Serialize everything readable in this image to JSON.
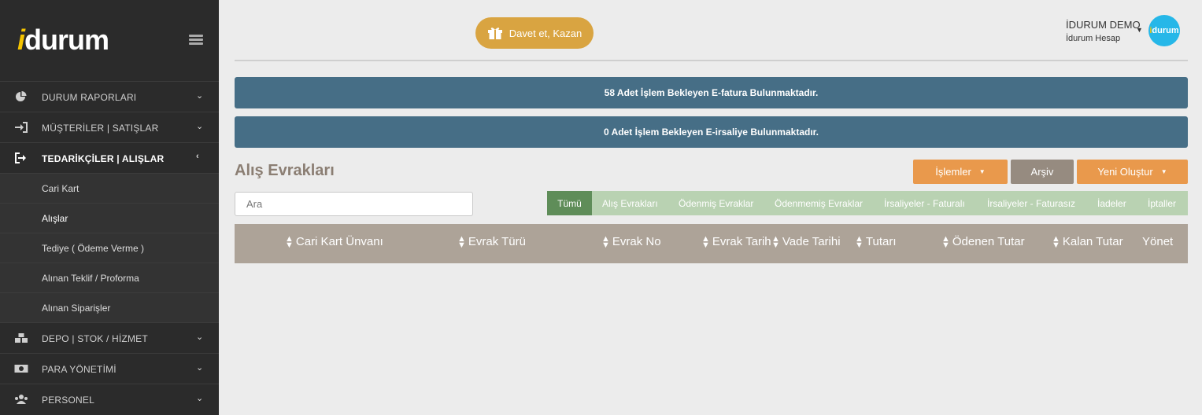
{
  "brand": {
    "logo_prefix": "i",
    "logo_rest": "durum"
  },
  "sidebar": {
    "items": [
      {
        "label": "DURUM RAPORLARI",
        "icon": "pie-chart-icon",
        "chevron": "⌄",
        "active": false
      },
      {
        "label": "MÜŞTERİLER | SATIŞLAR",
        "icon": "sign-in-icon",
        "chevron": "⌄",
        "active": false
      },
      {
        "label": "TEDARİKÇİLER | ALIŞLAR",
        "icon": "sign-out-icon",
        "chevron": "‹",
        "active": true
      },
      {
        "label": "DEPO | STOK / HİZMET",
        "icon": "boxes-icon",
        "chevron": "⌄",
        "active": false
      },
      {
        "label": "PARA YÖNETİMİ",
        "icon": "money-icon",
        "chevron": "⌄",
        "active": false
      },
      {
        "label": "PERSONEL",
        "icon": "users-icon",
        "chevron": "⌄",
        "active": false
      }
    ],
    "subitems": [
      {
        "label": "Cari Kart"
      },
      {
        "label": "Alışlar"
      },
      {
        "label": "Tediye ( Ödeme Verme )"
      },
      {
        "label": "Alınan Teklif / Proforma"
      },
      {
        "label": "Alınan Siparişler"
      }
    ]
  },
  "header": {
    "invite_label": "Davet et, Kazan",
    "user_name": "İDURUM DEMO",
    "user_account": "İdurum Hesap",
    "avatar_prefix": "i",
    "avatar_rest": "durum"
  },
  "banners": {
    "efatura": "58 Adet İşlem Bekleyen E-fatura Bulunmaktadır.",
    "eirsaliye": "0 Adet İşlem Bekleyen E-irsaliye Bulunmaktadır."
  },
  "main": {
    "title": "Alış Evrakları",
    "actions": {
      "islemler": "İşlemler",
      "arsiv": "Arşiv",
      "yeni": "Yeni Oluştur"
    },
    "search_placeholder": "Ara",
    "filters": [
      "Tümü",
      "Alış Evrakları",
      "Ödenmiş Evraklar",
      "Ödenmemiş Evraklar",
      "İrsaliyeler - Faturalı",
      "İrsaliyeler - Faturasız",
      "İadeler",
      "İptaller"
    ],
    "columns": [
      "Cari Kart Ünvanı",
      "Evrak Türü",
      "Evrak No",
      "Evrak Tarih",
      "Vade Tarihi",
      "Tutarı",
      "Ödenen Tutar",
      "Kalan Tutar",
      "Yönet"
    ]
  },
  "colors": {
    "sidebar_bg": "#2b2b2b",
    "banner_bg": "#466e86",
    "islemler_btn": "#e9994c",
    "arsiv_btn": "#968b80",
    "yeni_btn": "#e9994c",
    "filter_bg": "#b9d2b2",
    "filter_active": "#5f8d59",
    "table_head": "#ada398",
    "invite_btn": "#d9a441",
    "avatar": "#26b7e8",
    "logo_accent": "#f5c400"
  }
}
